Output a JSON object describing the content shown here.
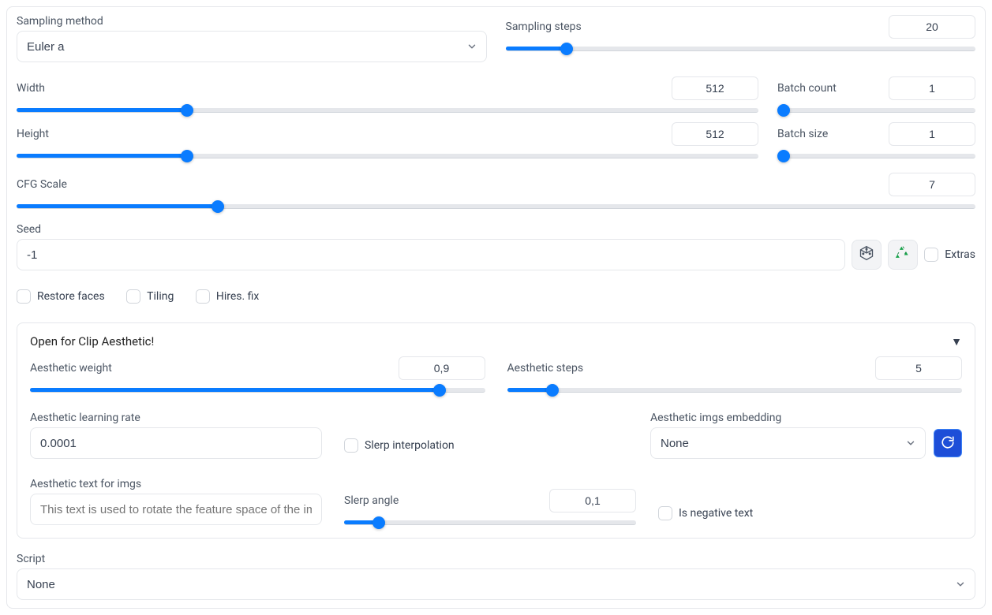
{
  "sampling_method": {
    "label": "Sampling method",
    "value": "Euler a"
  },
  "sampling_steps": {
    "label": "Sampling steps",
    "value": "20",
    "fillPct": 13
  },
  "width": {
    "label": "Width",
    "value": "512",
    "fillPct": 23
  },
  "height": {
    "label": "Height",
    "value": "512",
    "fillPct": 23
  },
  "batch_count": {
    "label": "Batch count",
    "value": "1",
    "fillPct": 3
  },
  "batch_size": {
    "label": "Batch size",
    "value": "1",
    "fillPct": 3
  },
  "cfg": {
    "label": "CFG Scale",
    "value": "7",
    "fillPct": 21
  },
  "seed": {
    "label": "Seed",
    "value": "-1",
    "extras_label": "Extras"
  },
  "checks": {
    "restore_faces": "Restore faces",
    "tiling": "Tiling",
    "hires_fix": "Hires. fix"
  },
  "aesthetic": {
    "title": "Open for Clip Aesthetic!",
    "weight": {
      "label": "Aesthetic weight",
      "value": "0,9",
      "fillPct": 90
    },
    "steps": {
      "label": "Aesthetic steps",
      "value": "5",
      "fillPct": 10
    },
    "lr": {
      "label": "Aesthetic learning rate",
      "value": "0.0001"
    },
    "slerp_interp": "Slerp interpolation",
    "embedding": {
      "label": "Aesthetic imgs embedding",
      "value": "None"
    },
    "text_for_imgs": {
      "label": "Aesthetic text for imgs",
      "placeholder": "This text is used to rotate the feature space of the imgs embs"
    },
    "slerp_angle": {
      "label": "Slerp angle",
      "value": "0,1",
      "fillPct": 12
    },
    "is_negative": "Is negative text"
  },
  "script": {
    "label": "Script",
    "value": "None"
  }
}
